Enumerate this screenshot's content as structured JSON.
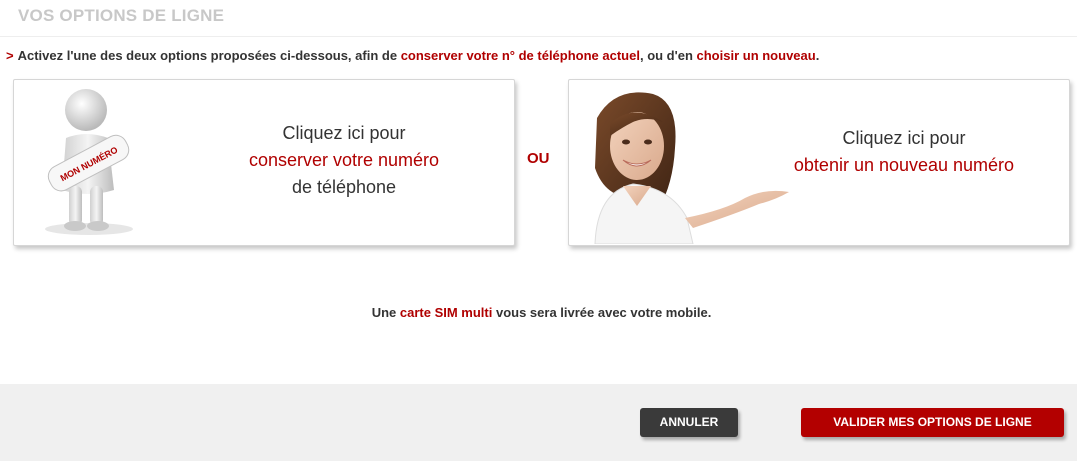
{
  "header": {
    "title": "VOS OPTIONS DE LIGNE"
  },
  "intro": {
    "arrow": ">",
    "part1": "Activez l'une des deux options proposées ci-dessous, afin de",
    "link1": "conserver votre n° de téléphone actuel",
    "part2": ", ou d'en",
    "link2": "choisir un nouveau",
    "part3": "."
  },
  "options": {
    "keep": {
      "line1": "Cliquez ici pour",
      "line2": "conserver votre numéro",
      "line3": "de téléphone",
      "sign_text": "MON NUMÉRO"
    },
    "or": "OU",
    "new": {
      "line1": "Cliquez ici pour",
      "line2": "obtenir un nouveau numéro"
    }
  },
  "sim_note": {
    "part1": "Une",
    "highlight": "carte SIM multi",
    "part2": "vous sera livrée avec votre mobile."
  },
  "footer": {
    "cancel_label": "ANNULER",
    "validate_label": "VALIDER MES OPTIONS DE LIGNE"
  },
  "colors": {
    "accent": "#b00000",
    "title_grey": "#c8c8c8",
    "cancel_bg": "#3a3a3a",
    "footer_bg": "#f0f0f0"
  }
}
